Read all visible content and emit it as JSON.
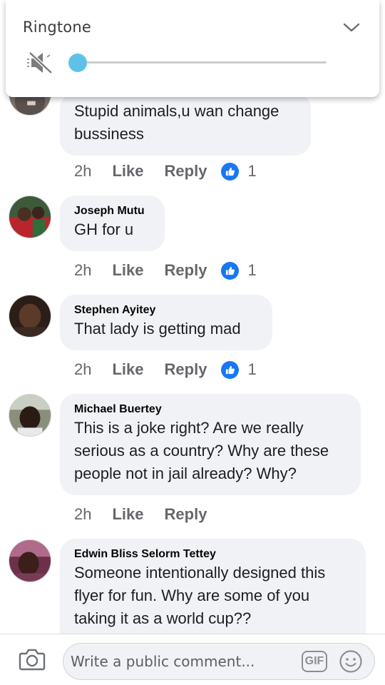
{
  "overlay": {
    "title": "Ringtone",
    "volume_level": 0.0,
    "icons": {
      "expand": "chevron-down-icon",
      "mute": "speaker-muted-icon"
    },
    "accent_color": "#5ec2e8"
  },
  "comments": [
    {
      "author": "",
      "text": "Stupid animals,u wan change bussiness",
      "time": "2h",
      "like_label": "Like",
      "reply_label": "Reply",
      "reactions": "1"
    },
    {
      "author": "Joseph Mutu",
      "text": "GH for u",
      "time": "2h",
      "like_label": "Like",
      "reply_label": "Reply",
      "reactions": "1"
    },
    {
      "author": "Stephen Ayitey",
      "text": "That lady is getting mad",
      "time": "2h",
      "like_label": "Like",
      "reply_label": "Reply",
      "reactions": "1"
    },
    {
      "author": "Michael Buertey",
      "text": "This is a joke right? Are we really serious as a country? Why are these people not in jail already? Why?",
      "time": "2h",
      "like_label": "Like",
      "reply_label": "Reply",
      "reactions": ""
    },
    {
      "author": "Edwin Bliss Selorm Tettey",
      "text": "Someone intentionally designed this flyer for fun. Why are some of you taking it as a world cup??",
      "time": "",
      "like_label": "",
      "reply_label": "",
      "reactions": ""
    }
  ],
  "composer": {
    "placeholder": "Write a public comment...",
    "gif_label": "GIF",
    "icons": {
      "camera": "camera-icon",
      "emoji": "emoji-icon"
    }
  },
  "colors": {
    "like_blue": "#1877f2",
    "bubble_bg": "#f0f2f5",
    "meta_gray": "#65676b"
  }
}
